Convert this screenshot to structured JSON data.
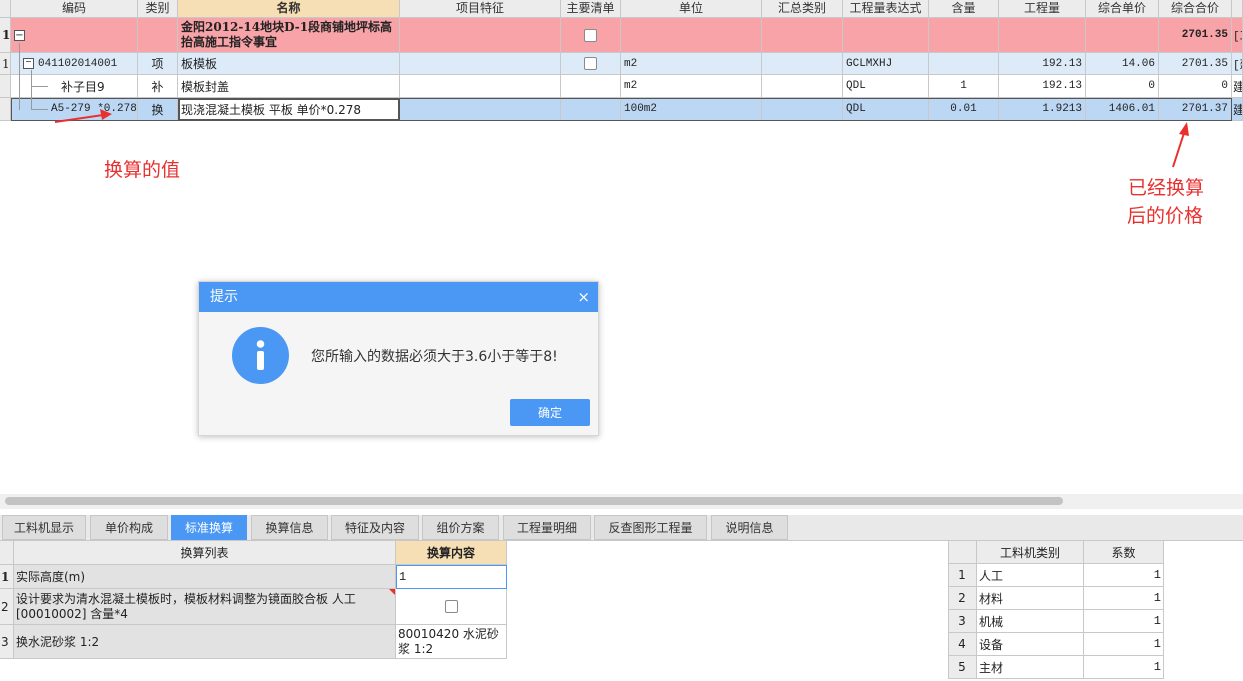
{
  "grid": {
    "headers": [
      "编码",
      "类别",
      "名称",
      "项目特征",
      "主要清单",
      "单位",
      "汇总类别",
      "工程量表达式",
      "含量",
      "工程量",
      "综合单价",
      "综合合价"
    ],
    "rows": [
      {
        "num": "1",
        "code": "",
        "type": "",
        "name_line1": "金阳2012-14地块D-1段商铺地坪标高",
        "name_line2": "抬高施工指令事宜",
        "unit": "",
        "expr": "",
        "content": "",
        "qty": "",
        "price": "",
        "total": "2701.35",
        "extra": "[工"
      },
      {
        "num": "1",
        "code": "041102014001",
        "type": "项",
        "name": "板模板",
        "unit": "m2",
        "expr": "GCLMXHJ",
        "content": "",
        "qty": "192.13",
        "price": "14.06",
        "total": "2701.35",
        "extra": "[建"
      },
      {
        "num": "",
        "code": "补子目9",
        "type": "补",
        "name": "模板封盖",
        "unit": "m2",
        "expr": "QDL",
        "content": "1",
        "qty": "192.13",
        "price": "0",
        "total": "0",
        "extra": "建"
      },
      {
        "num": "",
        "code": "A5-279 *0.278",
        "type": "换",
        "name": "现浇混凝土模板 平板  单价*0.278",
        "unit": "100m2",
        "expr": "QDL",
        "content": "0.01",
        "qty": "1.9213",
        "price": "1406.01",
        "total": "2701.37",
        "extra": "建"
      }
    ]
  },
  "annotations": {
    "left": "换算的值",
    "right_line1": "已经换算",
    "right_line2": "后的价格"
  },
  "dialog": {
    "title": "提示",
    "close": "×",
    "message": "您所输入的数据必须大于3.6小于等于8!",
    "ok_label": "确定",
    "icon_glyph": "i"
  },
  "tabs": [
    "工料机显示",
    "单价构成",
    "标准换算",
    "换算信息",
    "特征及内容",
    "组价方案",
    "工程量明细",
    "反查图形工程量",
    "说明信息"
  ],
  "tabs_active": "标准换算",
  "conversion": {
    "headers": [
      "换算列表",
      "换算内容"
    ],
    "rows": [
      {
        "num": "1",
        "item": "实际高度(m)",
        "value": "1"
      },
      {
        "num": "2",
        "item_line1": "设计要求为清水混凝土模板时，模板材料调整为镜面胶合板 人工",
        "item_line2": "[00010002] 含量*4",
        "value": ""
      },
      {
        "num": "3",
        "item": "换水泥砂浆 1:2",
        "value_line1": "80010420  水泥砂",
        "value_line2": "浆 1:2"
      }
    ]
  },
  "coefficients": {
    "headers": [
      "工料机类别",
      "系数"
    ],
    "rows": [
      {
        "num": "1",
        "category": "人工",
        "factor": "1"
      },
      {
        "num": "2",
        "category": "材料",
        "factor": "1"
      },
      {
        "num": "3",
        "category": "机械",
        "factor": "1"
      },
      {
        "num": "4",
        "category": "设备",
        "factor": "1"
      },
      {
        "num": "5",
        "category": "主材",
        "factor": "1"
      }
    ]
  },
  "colors": {
    "header_bg": "#ececec",
    "header_highlight": "#f7dfb5",
    "row_pink": "#f7a3a8",
    "row_light_blue": "#ddeaf7",
    "row_selected": "#bcd7f4",
    "accent_blue": "#4a98f4",
    "annotation_red": "#e8312f"
  }
}
